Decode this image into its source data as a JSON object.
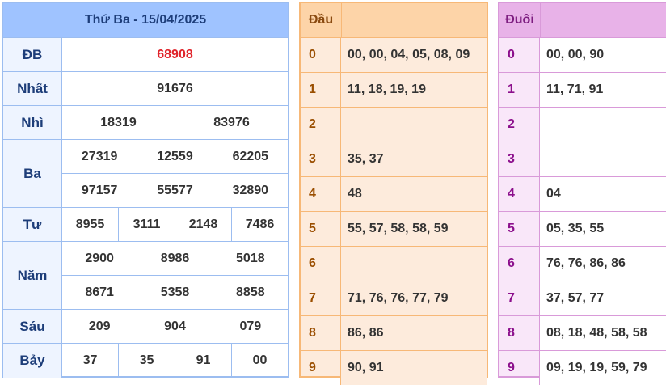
{
  "results": {
    "title": "Thứ Ba - 15/04/2025",
    "rows": [
      {
        "label": "ĐB",
        "lines": [
          [
            "68908"
          ]
        ],
        "special": true
      },
      {
        "label": "Nhất",
        "lines": [
          [
            "91676"
          ]
        ]
      },
      {
        "label": "Nhì",
        "lines": [
          [
            "18319",
            "83976"
          ]
        ]
      },
      {
        "label": "Ba",
        "lines": [
          [
            "27319",
            "12559",
            "62205"
          ],
          [
            "97157",
            "55577",
            "32890"
          ]
        ]
      },
      {
        "label": "Tư",
        "lines": [
          [
            "8955",
            "3111",
            "2148",
            "7486"
          ]
        ]
      },
      {
        "label": "Năm",
        "lines": [
          [
            "2900",
            "8986",
            "5018"
          ],
          [
            "8671",
            "5358",
            "8858"
          ]
        ]
      },
      {
        "label": "Sáu",
        "lines": [
          [
            "209",
            "904",
            "079"
          ]
        ]
      },
      {
        "label": "Bảy",
        "lines": [
          [
            "37",
            "35",
            "91",
            "00"
          ]
        ]
      }
    ]
  },
  "dau": {
    "header": "Đầu",
    "rows": [
      {
        "digit": "0",
        "values": "00, 00, 04, 05, 08, 09"
      },
      {
        "digit": "1",
        "values": "11, 18, 19, 19"
      },
      {
        "digit": "2",
        "values": ""
      },
      {
        "digit": "3",
        "values": "35, 37"
      },
      {
        "digit": "4",
        "values": "48"
      },
      {
        "digit": "5",
        "values": "55, 57, 58, 58, 59"
      },
      {
        "digit": "6",
        "values": ""
      },
      {
        "digit": "7",
        "values": "71, 76, 76, 77, 79"
      },
      {
        "digit": "8",
        "values": "86, 86"
      },
      {
        "digit": "9",
        "values": "90, 91"
      }
    ]
  },
  "duoi": {
    "header": "Đuôi",
    "rows": [
      {
        "digit": "0",
        "values": "00, 00, 90"
      },
      {
        "digit": "1",
        "values": "11, 71, 91"
      },
      {
        "digit": "2",
        "values": ""
      },
      {
        "digit": "3",
        "values": ""
      },
      {
        "digit": "4",
        "values": "04"
      },
      {
        "digit": "5",
        "values": "05, 35, 55"
      },
      {
        "digit": "6",
        "values": "76, 76, 86, 86"
      },
      {
        "digit": "7",
        "values": "37, 57, 77"
      },
      {
        "digit": "8",
        "values": "08, 18, 48, 58, 58"
      },
      {
        "digit": "9",
        "values": "09, 19, 19, 59, 79"
      }
    ]
  },
  "colors": {
    "results_header": "#9fc3ff",
    "special_prize": "#e0242b",
    "dau_header": "#fdd4a8",
    "duoi_header": "#e8b2e8"
  }
}
